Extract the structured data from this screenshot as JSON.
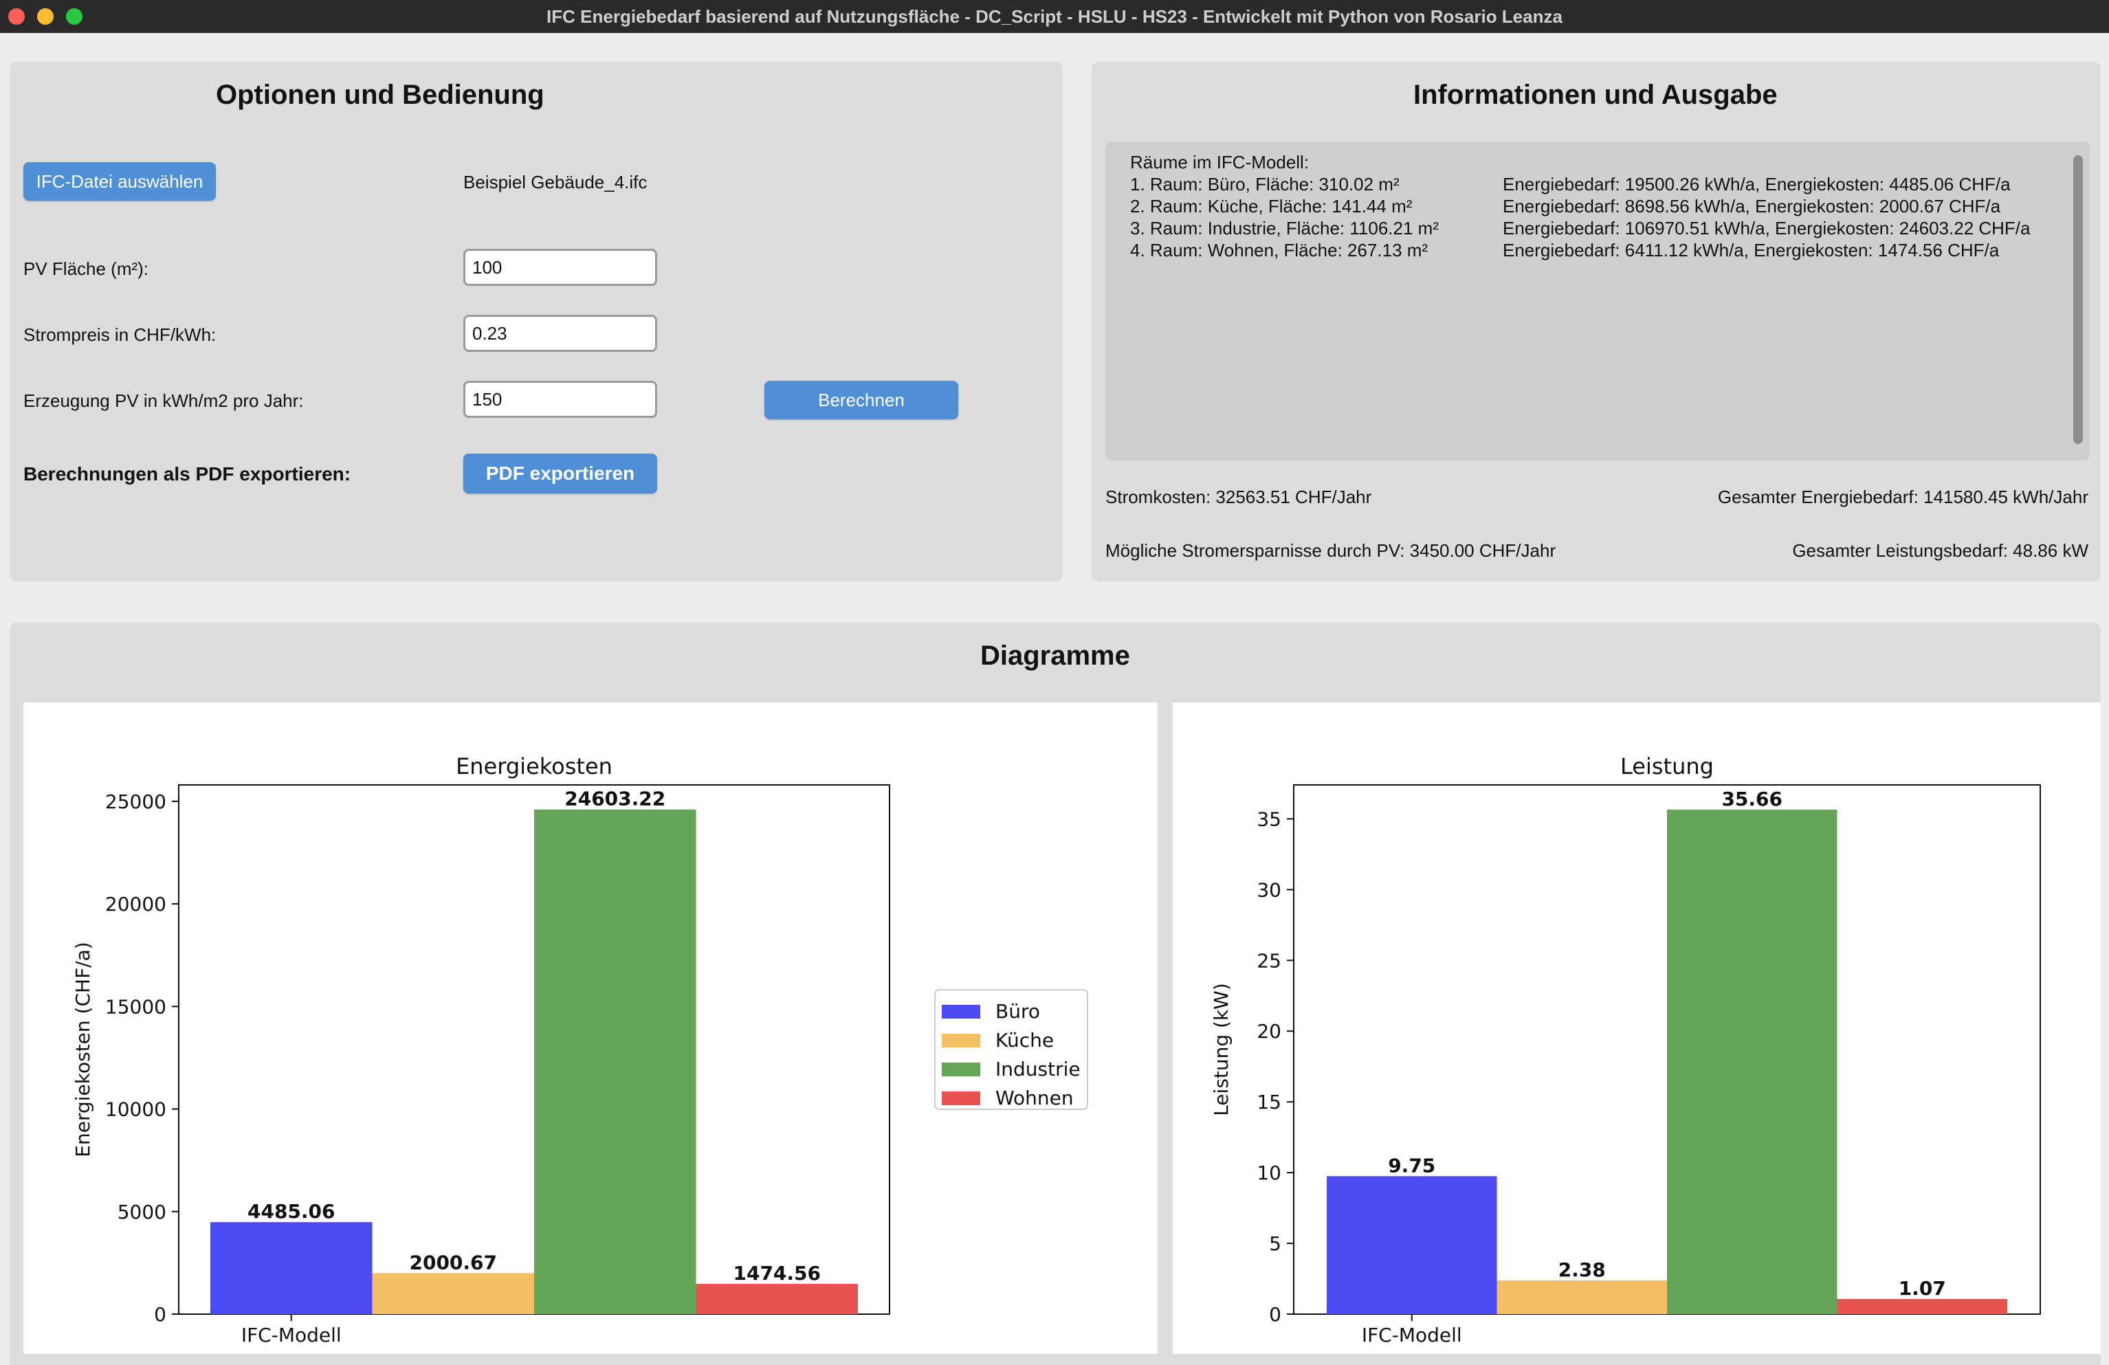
{
  "window": {
    "title": "IFC Energiebedarf basierend auf Nutzungsfläche - DC_Script - HSLU - HS23 - Entwickelt mit Python von Rosario Leanza"
  },
  "options": {
    "title": "Optionen und Bedienung",
    "select_button": "IFC-Datei auswählen",
    "file_name": "Beispiel Gebäude_4.ifc",
    "pv_area_label": "PV Fläche (m²):",
    "pv_area_value": "100",
    "price_label": "Strompreis in CHF/kWh:",
    "price_value": "0.23",
    "production_label": "Erzeugung PV in kWh/m2 pro Jahr:",
    "production_value": "150",
    "calc_button": "Berechnen",
    "export_label": "Berechnungen als PDF exportieren:",
    "export_button": "PDF exportieren"
  },
  "info": {
    "title": "Informationen und Ausgabe",
    "rooms_heading": "Räume im IFC-Modell:",
    "rooms": [
      {
        "left": "1. Raum: Büro, Fläche: 310.02 m²",
        "right": "Energiebedarf: 19500.26 kWh/a, Energiekosten: 4485.06 CHF/a"
      },
      {
        "left": "2. Raum: Küche, Fläche: 141.44 m²",
        "right": "Energiebedarf: 8698.56 kWh/a, Energiekosten: 2000.67 CHF/a"
      },
      {
        "left": "3. Raum: Industrie, Fläche: 1106.21 m²",
        "right": "Energiebedarf: 106970.51 kWh/a, Energiekosten: 24603.22 CHF/a"
      },
      {
        "left": "4. Raum: Wohnen, Fläche: 267.13 m²",
        "right": "Energiebedarf: 6411.12 kWh/a, Energiekosten: 1474.56 CHF/a"
      }
    ],
    "stromkosten": "Stromkosten: 32563.51 CHF/Jahr",
    "gesamt_energie": "Gesamter Energiebedarf: 141580.45 kWh/Jahr",
    "ersparnis": "Mögliche Stromersparnisse durch PV: 3450.00 CHF/Jahr",
    "gesamt_leistung": "Gesamter Leistungsbedarf: 48.86 kW"
  },
  "diagrams": {
    "title": "Diagramme"
  },
  "chart_data": [
    {
      "type": "bar",
      "title": "Energiekosten",
      "xlabel": "",
      "ylabel": "Energiekosten (CHF/a)",
      "categories": [
        "IFC-Modell"
      ],
      "series": [
        {
          "name": "Büro",
          "color": "#4b4bf5",
          "values": [
            4485.06
          ],
          "label": "4485.06"
        },
        {
          "name": "Küche",
          "color": "#f5c064",
          "values": [
            2000.67
          ],
          "label": "2000.67"
        },
        {
          "name": "Industrie",
          "color": "#63a655",
          "values": [
            24603.22
          ],
          "label": "24603.22"
        },
        {
          "name": "Wohnen",
          "color": "#e8524f",
          "values": [
            1474.56
          ],
          "label": "1474.56"
        }
      ],
      "ylim": [
        0,
        25800
      ],
      "yticks": [
        "0",
        "5000",
        "10000",
        "15000",
        "20000",
        "25000"
      ],
      "ytick_values": [
        0,
        5000,
        10000,
        15000,
        20000,
        25000
      ],
      "legend": "right",
      "grid": false
    },
    {
      "type": "bar",
      "title": "Leistung",
      "xlabel": "",
      "ylabel": "Leistung (kW)",
      "categories": [
        "IFC-Modell"
      ],
      "series": [
        {
          "name": "Büro",
          "color": "#4b4bf5",
          "values": [
            9.75
          ],
          "label": "9.75"
        },
        {
          "name": "Küche",
          "color": "#f5c064",
          "values": [
            2.38
          ],
          "label": "2.38"
        },
        {
          "name": "Industrie",
          "color": "#63a655",
          "values": [
            35.66
          ],
          "label": "35.66"
        },
        {
          "name": "Wohnen",
          "color": "#e8524f",
          "values": [
            1.07
          ],
          "label": "1.07"
        }
      ],
      "ylim": [
        0,
        37.4
      ],
      "yticks": [
        "0",
        "5",
        "10",
        "15",
        "20",
        "25",
        "30",
        "35"
      ],
      "ytick_values": [
        0,
        5,
        10,
        15,
        20,
        25,
        30,
        35
      ],
      "legend": "none",
      "grid": false
    }
  ]
}
